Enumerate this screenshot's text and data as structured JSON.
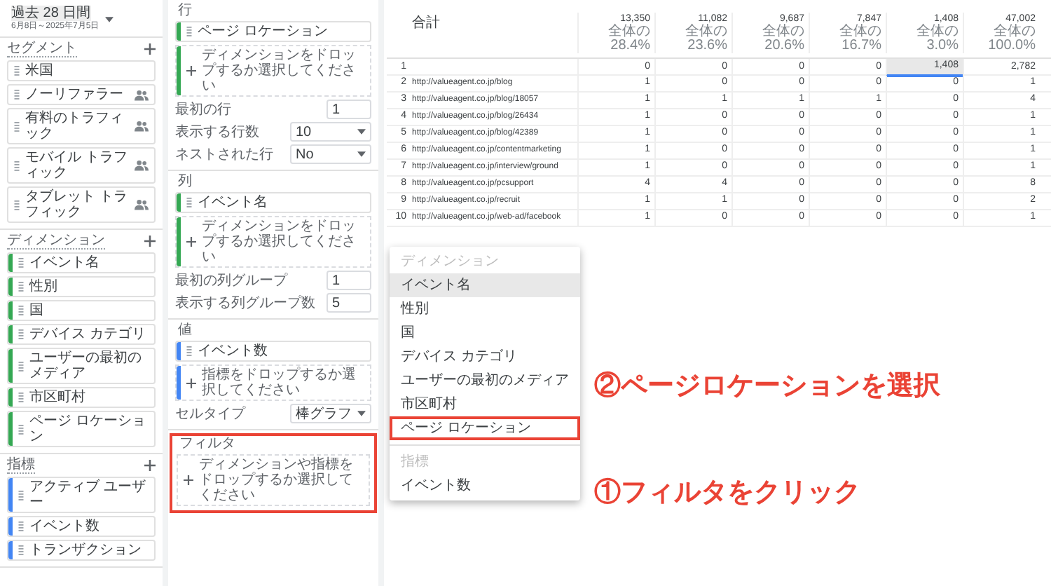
{
  "sidebar": {
    "date_range": {
      "label": "過去 28 日間",
      "dates": "6月8日～2025年7月5日"
    },
    "sections": [
      {
        "title": "セグメント",
        "kind": "segment",
        "items": [
          {
            "label": "米国",
            "shared": false
          },
          {
            "label": "ノーリファラー",
            "shared": true
          },
          {
            "label": "有料のトラフィック",
            "shared": true
          },
          {
            "label": "モバイル トラフィック",
            "shared": true
          },
          {
            "label": "タブレット トラフィック",
            "shared": true
          }
        ]
      },
      {
        "title": "ディメンション",
        "kind": "dimension",
        "color": "#34a853",
        "items": [
          {
            "label": "イベント名"
          },
          {
            "label": "性別"
          },
          {
            "label": "国"
          },
          {
            "label": "デバイス カテゴリ"
          },
          {
            "label": "ユーザーの最初のメディア"
          },
          {
            "label": "市区町村"
          },
          {
            "label": "ページ ロケーション"
          }
        ]
      },
      {
        "title": "指標",
        "kind": "metric",
        "color": "#4285f4",
        "items": [
          {
            "label": "アクティブ ユーザー"
          },
          {
            "label": "イベント数"
          },
          {
            "label": "トランザクション"
          }
        ]
      }
    ]
  },
  "settings": {
    "groups": [
      {
        "title": "行",
        "callout": false,
        "items": [
          {
            "kind": "chip",
            "label": "ページ ロケーション",
            "color": "#34a853"
          },
          {
            "kind": "drop",
            "text": "ディメンションをドロップするか選択してください",
            "color": "#34a853"
          },
          {
            "kind": "input",
            "label": "最初の行",
            "value": "1"
          },
          {
            "kind": "select",
            "label": "表示する行数",
            "value": "10"
          },
          {
            "kind": "select",
            "label": "ネストされた行",
            "value": "No"
          }
        ]
      },
      {
        "title": "列",
        "callout": false,
        "items": [
          {
            "kind": "chip",
            "label": "イベント名",
            "color": "#34a853"
          },
          {
            "kind": "drop",
            "text": "ディメンションをドロップするか選択してください",
            "color": "#34a853"
          },
          {
            "kind": "input",
            "label": "最初の列グループ",
            "value": "1"
          },
          {
            "kind": "input",
            "label": "表示する列グループ数",
            "value": "5"
          }
        ]
      },
      {
        "title": "値",
        "callout": false,
        "items": [
          {
            "kind": "chip",
            "label": "イベント数",
            "color": "#4285f4"
          },
          {
            "kind": "drop",
            "text": "指標をドロップするか選択してください",
            "color": "#4285f4"
          },
          {
            "kind": "select",
            "label": "セルタイプ",
            "value": "棒グラフ"
          }
        ]
      },
      {
        "title": "フィルタ",
        "callout": true,
        "items": [
          {
            "kind": "drop",
            "text": "ディメンションや指標をドロップするか選択してください"
          }
        ]
      }
    ]
  },
  "table": {
    "total_label": "合計",
    "totals": [
      {
        "value": "13,350",
        "share": "全体の 28.4%"
      },
      {
        "value": "11,082",
        "share": "全体の 23.6%"
      },
      {
        "value": "9,687",
        "share": "全体の 20.6%"
      },
      {
        "value": "7,847",
        "share": "全体の 16.7%"
      },
      {
        "value": "1,408",
        "share": "全体の 3.0%"
      },
      {
        "value": "47,002",
        "share": "全体の 100.0%"
      }
    ],
    "rows": [
      {
        "index": "1",
        "cells": [
          {
            "text": "0",
            "selected": false
          },
          {
            "text": "0",
            "selected": false
          },
          {
            "text": "0",
            "selected": false
          },
          {
            "text": "0",
            "selected": false
          },
          {
            "text": "1,408",
            "selected": true
          },
          {
            "text": "2,782",
            "selected": false
          }
        ]
      },
      {
        "index": "2",
        "url": "http://valueagent.co.jp/blog",
        "cells": [
          {
            "text": "1",
            "selected": false
          },
          {
            "text": "0",
            "selected": false
          },
          {
            "text": "0",
            "selected": false
          },
          {
            "text": "0",
            "selected": false
          },
          {
            "text": "0",
            "selected": false
          },
          {
            "text": "1",
            "selected": false
          }
        ]
      },
      {
        "index": "3",
        "url": "http://valueagent.co.jp/blog/18057",
        "cells": [
          {
            "text": "1",
            "selected": false
          },
          {
            "text": "1",
            "selected": false
          },
          {
            "text": "1",
            "selected": false
          },
          {
            "text": "1",
            "selected": false
          },
          {
            "text": "0",
            "selected": false
          },
          {
            "text": "4",
            "selected": false
          }
        ]
      },
      {
        "index": "4",
        "url": "http://valueagent.co.jp/blog/26434",
        "cells": [
          {
            "text": "1",
            "selected": false
          },
          {
            "text": "0",
            "selected": false
          },
          {
            "text": "0",
            "selected": false
          },
          {
            "text": "0",
            "selected": false
          },
          {
            "text": "0",
            "selected": false
          },
          {
            "text": "1",
            "selected": false
          }
        ]
      },
      {
        "index": "5",
        "url": "http://valueagent.co.jp/blog/42389",
        "cells": [
          {
            "text": "1",
            "selected": false
          },
          {
            "text": "0",
            "selected": false
          },
          {
            "text": "0",
            "selected": false
          },
          {
            "text": "0",
            "selected": false
          },
          {
            "text": "0",
            "selected": false
          },
          {
            "text": "1",
            "selected": false
          }
        ]
      },
      {
        "index": "6",
        "url": "http://valueagent.co.jp/contentmarketing",
        "cells": [
          {
            "text": "1",
            "selected": false
          },
          {
            "text": "0",
            "selected": false
          },
          {
            "text": "0",
            "selected": false
          },
          {
            "text": "0",
            "selected": false
          },
          {
            "text": "0",
            "selected": false
          },
          {
            "text": "1",
            "selected": false
          }
        ]
      },
      {
        "index": "7",
        "url": "http://valueagent.co.jp/interview/ground",
        "cells": [
          {
            "text": "1",
            "selected": false
          },
          {
            "text": "0",
            "selected": false
          },
          {
            "text": "0",
            "selected": false
          },
          {
            "text": "0",
            "selected": false
          },
          {
            "text": "0",
            "selected": false
          },
          {
            "text": "1",
            "selected": false
          }
        ]
      },
      {
        "index": "8",
        "url": "http://valueagent.co.jp/pcsupport",
        "cells": [
          {
            "text": "4",
            "selected": false
          },
          {
            "text": "4",
            "selected": false
          },
          {
            "text": "0",
            "selected": false
          },
          {
            "text": "0",
            "selected": false
          },
          {
            "text": "0",
            "selected": false
          },
          {
            "text": "8",
            "selected": false
          }
        ]
      },
      {
        "index": "9",
        "url": "http://valueagent.co.jp/recruit",
        "cells": [
          {
            "text": "1",
            "selected": false
          },
          {
            "text": "1",
            "selected": false
          },
          {
            "text": "0",
            "selected": false
          },
          {
            "text": "0",
            "selected": false
          },
          {
            "text": "0",
            "selected": false
          },
          {
            "text": "2",
            "selected": false
          }
        ]
      },
      {
        "index": "10",
        "url": "http://valueagent.co.jp/web-ad/facebook",
        "cells": [
          {
            "text": "1",
            "selected": false
          },
          {
            "text": "0",
            "selected": false
          },
          {
            "text": "0",
            "selected": false
          },
          {
            "text": "0",
            "selected": false
          },
          {
            "text": "0",
            "selected": false
          },
          {
            "text": "1",
            "selected": false
          }
        ]
      }
    ]
  },
  "menu": {
    "sections": [
      {
        "title": "ディメンション",
        "items": [
          {
            "label": "イベント名",
            "selected": true,
            "callout": false
          },
          {
            "label": "性別",
            "selected": false,
            "callout": false
          },
          {
            "label": "国",
            "selected": false,
            "callout": false
          },
          {
            "label": "デバイス カテゴリ",
            "selected": false,
            "callout": false
          },
          {
            "label": "ユーザーの最初のメディア",
            "selected": false,
            "callout": false
          },
          {
            "label": "市区町村",
            "selected": false,
            "callout": false
          },
          {
            "label": "ページ ロケーション",
            "selected": false,
            "callout": true
          }
        ]
      },
      {
        "title": "指標",
        "items": [
          {
            "label": "イベント数",
            "selected": false,
            "callout": false
          }
        ]
      }
    ]
  },
  "annotations": [
    {
      "text": "②ページロケーションを選択"
    },
    {
      "text": "①フィルタをクリック"
    }
  ]
}
